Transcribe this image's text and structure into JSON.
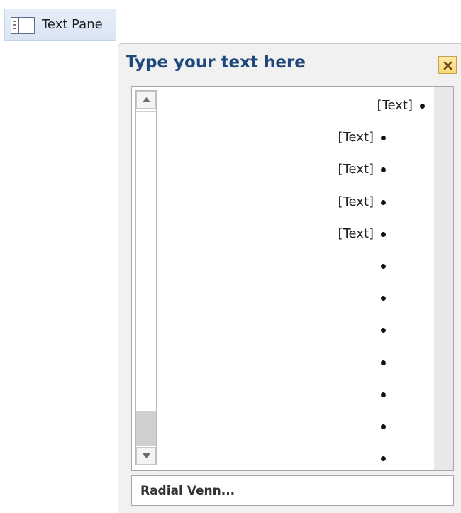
{
  "toolbar": {
    "text_pane_label": "Text Pane",
    "text_pane_icon": "text-pane-icon"
  },
  "pane": {
    "title": "Type your text here",
    "close_icon": "close-icon",
    "items": [
      {
        "text": "[Text]",
        "level": 1
      },
      {
        "text": "[Text]",
        "level": 2
      },
      {
        "text": "[Text]",
        "level": 2
      },
      {
        "text": "[Text]",
        "level": 2
      },
      {
        "text": "[Text]",
        "level": 2
      },
      {
        "text": "",
        "level": 2
      },
      {
        "text": "",
        "level": 2
      },
      {
        "text": "",
        "level": 2
      },
      {
        "text": "",
        "level": 2
      },
      {
        "text": "",
        "level": 2
      },
      {
        "text": "",
        "level": 2
      },
      {
        "text": "",
        "level": 2
      }
    ],
    "scrollbar": {
      "up_icon": "scroll-up-arrow-icon",
      "down_icon": "scroll-down-arrow-icon"
    },
    "layout_name": "Radial Venn..."
  },
  "colors": {
    "title": "#1f497d",
    "pane_background": "#f1f1f1",
    "close_button": "#f8d77c",
    "button_highlight": "#d9e4f4"
  }
}
